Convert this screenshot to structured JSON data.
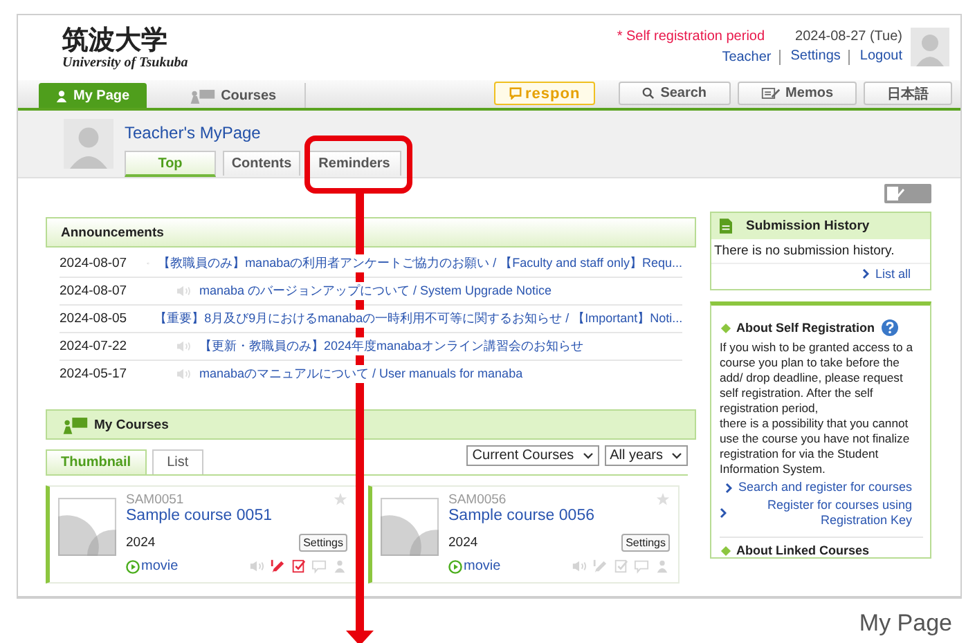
{
  "header": {
    "logo_title": "筑波大学",
    "logo_subtitle": "University of Tsukuba",
    "notice": "* Self registration period",
    "date": "2024-08-27 (Tue)",
    "links": [
      "Teacher",
      "Settings",
      "Logout"
    ]
  },
  "nav": {
    "tabs": [
      {
        "label": "My Page",
        "selected": true
      },
      {
        "label": "Courses",
        "selected": false
      }
    ],
    "respon": "respon",
    "buttons": [
      "Search",
      "Memos",
      "日本語"
    ]
  },
  "mypage": {
    "title": "Teacher's MyPage",
    "tabs": [
      {
        "label": "Top",
        "selected": true
      },
      {
        "label": "Contents",
        "selected": false
      },
      {
        "label": "Reminders",
        "selected": false
      }
    ]
  },
  "announcements": {
    "title": "Announcements",
    "rows": [
      {
        "date": "2024-08-07",
        "text": "【教職員のみ】manabaの利用者アンケートご協力のお願い / 【Faculty and staff only】Requ..."
      },
      {
        "date": "2024-08-07",
        "text": "manaba のバージョンアップについて / System Upgrade Notice"
      },
      {
        "date": "2024-08-05",
        "text": "【重要】8月及び9月におけるmanabaの一時利用不可等に関するお知らせ / 【Important】Noti..."
      },
      {
        "date": "2024-07-22",
        "text": "【更新・教職員のみ】2024年度manabaオンライン講習会のお知らせ"
      },
      {
        "date": "2024-05-17",
        "text": "manabaのマニュアルについて / User manuals for manaba"
      }
    ]
  },
  "my_courses": {
    "title": "My Courses",
    "tabs": [
      {
        "label": "Thumbnail",
        "selected": true
      },
      {
        "label": "List",
        "selected": false
      }
    ],
    "filters": [
      "Current Courses",
      "All years"
    ],
    "courses": [
      {
        "code": "SAM0051",
        "title": "Sample course 0051",
        "year": "2024",
        "settings": "Settings",
        "movie": "movie",
        "status_icons": [
          {
            "kind": "news",
            "alert": false
          },
          {
            "kind": "pencil",
            "alert": true
          },
          {
            "kind": "report",
            "alert": true
          },
          {
            "kind": "chat",
            "alert": false
          },
          {
            "kind": "person",
            "alert": false
          }
        ]
      },
      {
        "code": "SAM0056",
        "title": "Sample course 0056",
        "year": "2024",
        "settings": "Settings",
        "movie": "movie",
        "status_icons": [
          {
            "kind": "news",
            "alert": false
          },
          {
            "kind": "pencil",
            "alert": false
          },
          {
            "kind": "report",
            "alert": false
          },
          {
            "kind": "chat",
            "alert": false
          },
          {
            "kind": "person",
            "alert": false
          }
        ]
      }
    ]
  },
  "submission_history": {
    "title": "Submission History",
    "message": "There is no submission history.",
    "link": "List all"
  },
  "self_registration": {
    "title": "About Self Registration",
    "paragraphs": [
      "If you wish to be granted access to a course you plan to take before the add/ drop deadline, please request self registration. After the self registration period,",
      "there is a possibility that you cannot use the course you have not finalize registration for via the Student Information System."
    ],
    "links": [
      "Search and register for courses",
      "Register for courses using Registration Key"
    ],
    "next_title": "About Linked Courses"
  },
  "annotation": {
    "caption": "My Page"
  }
}
